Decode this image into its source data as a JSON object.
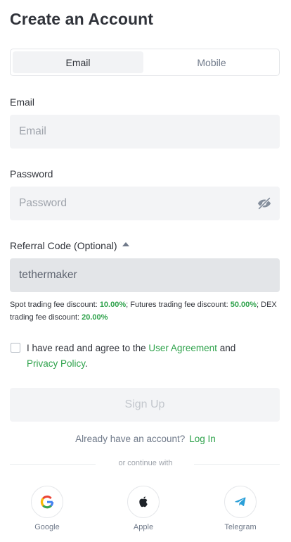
{
  "page": {
    "title": "Create an Account"
  },
  "tabs": [
    {
      "label": "Email",
      "active": true
    },
    {
      "label": "Mobile",
      "active": false
    }
  ],
  "email": {
    "label": "Email",
    "placeholder": "Email",
    "value": ""
  },
  "password": {
    "label": "Password",
    "placeholder": "Password",
    "value": "",
    "visibility_icon": "eye-off-icon"
  },
  "referral": {
    "label": "Referral Code (Optional)",
    "toggle_icon": "caret-up-icon",
    "value": "tethermaker"
  },
  "discounts": {
    "spot_label": "Spot trading fee discount: ",
    "spot_value": "10.00%",
    "futures_label": "; Futures trading fee discount: ",
    "futures_value": "50.00%",
    "dex_label": "; DEX trading fee discount: ",
    "dex_value": "20.00%"
  },
  "agreement": {
    "checked": false,
    "prefix": "I have read and agree to the ",
    "user_agreement": "User Agreement",
    "middle": " and ",
    "privacy_policy": "Privacy Policy",
    "suffix": "."
  },
  "signup": {
    "label": "Sign Up",
    "disabled": true
  },
  "login_prompt": {
    "text": "Already have an account?",
    "link": "Log In"
  },
  "continue_with": "or continue with",
  "social": [
    {
      "name": "Google",
      "icon": "google-icon"
    },
    {
      "name": "Apple",
      "icon": "apple-icon"
    },
    {
      "name": "Telegram",
      "icon": "telegram-icon"
    }
  ],
  "colors": {
    "accent": "#2ea24b",
    "field_bg": "#f3f4f6",
    "readonly_bg": "#e3e5e8",
    "text_primary": "#30333a",
    "text_secondary": "#707a8a"
  }
}
